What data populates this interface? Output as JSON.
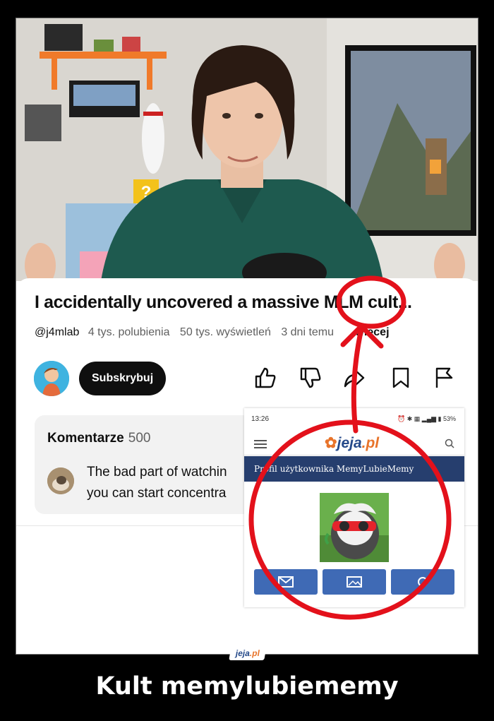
{
  "video": {
    "title": "I accidentally uncovered a massive MLM cult...",
    "channel": "@j4mlab",
    "likes": "4 tys. polubienia",
    "views": "50 tys. wyświetleń",
    "age": "3 dni temu",
    "more": "więcej",
    "subscribe_label": "Subskrybuj"
  },
  "comments": {
    "title": "Komentarze",
    "count": "500",
    "first_comment": "The bad part of watchi​ng...",
    "line1": "The bad part of watchin",
    "line2": "you can start concentra"
  },
  "phone": {
    "time": "13:26",
    "battery": "53%",
    "logo_main": "jeja",
    "logo_suffix": ".pl",
    "banner": "Profil użytkownika MemyLubieMemy"
  },
  "footer": {
    "logo_main": "jeja",
    "logo_suffix": ".pl",
    "caption": "Kult memylubiememy"
  },
  "colors": {
    "annotation_red": "#e3111b",
    "subscribe_bg": "#0f0f0f",
    "jeja_blue": "#264a8a",
    "jeja_orange": "#e8742b"
  }
}
